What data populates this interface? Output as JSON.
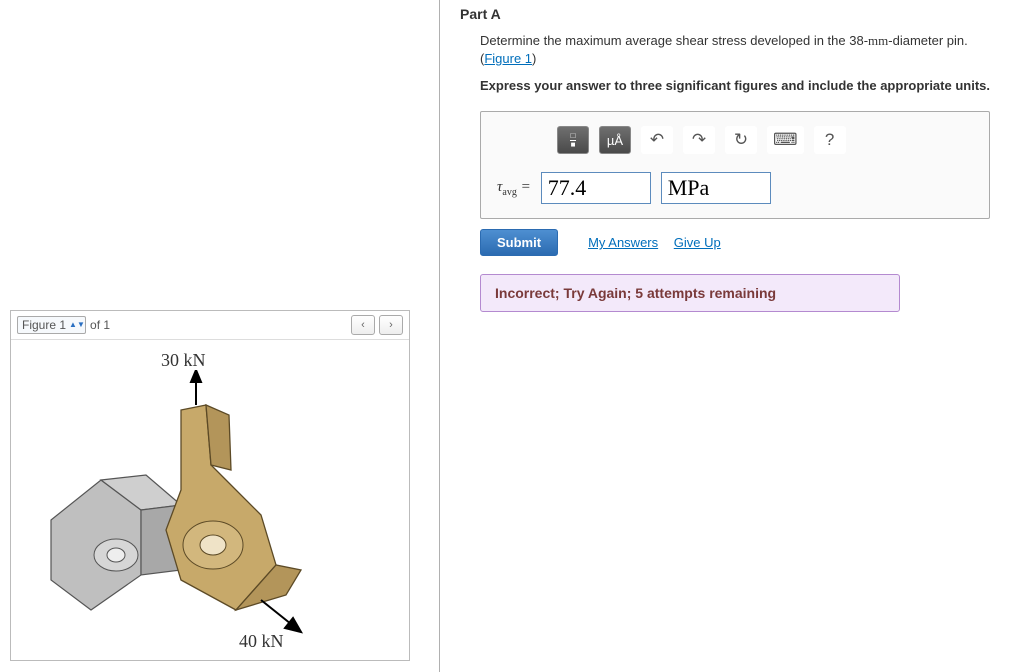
{
  "part": {
    "title": "Part A"
  },
  "prompt": {
    "line1a": "Determine the maximum average shear stress developed in the 38-",
    "line1b": "mm",
    "line1c": "-diameter pin.",
    "figlink_open": "(",
    "figlink": "Figure 1",
    "figlink_close": ")"
  },
  "instruction": "Express your answer to three significant figures and include the appropriate units.",
  "toolbar": {
    "units_label": "µÅ",
    "help": "?"
  },
  "answer": {
    "symbol_tau": "τ",
    "symbol_sub": "avg",
    "equals": " = ",
    "value": "77.4",
    "unit": "MPa"
  },
  "actions": {
    "submit": "Submit",
    "my_answers": "My Answers",
    "give_up": "Give Up"
  },
  "feedback": "Incorrect; Try Again; 5 attempts remaining",
  "figure": {
    "name": "Figure 1",
    "of": "of 1",
    "force_top": "30 kN",
    "force_bot": "40 kN"
  }
}
